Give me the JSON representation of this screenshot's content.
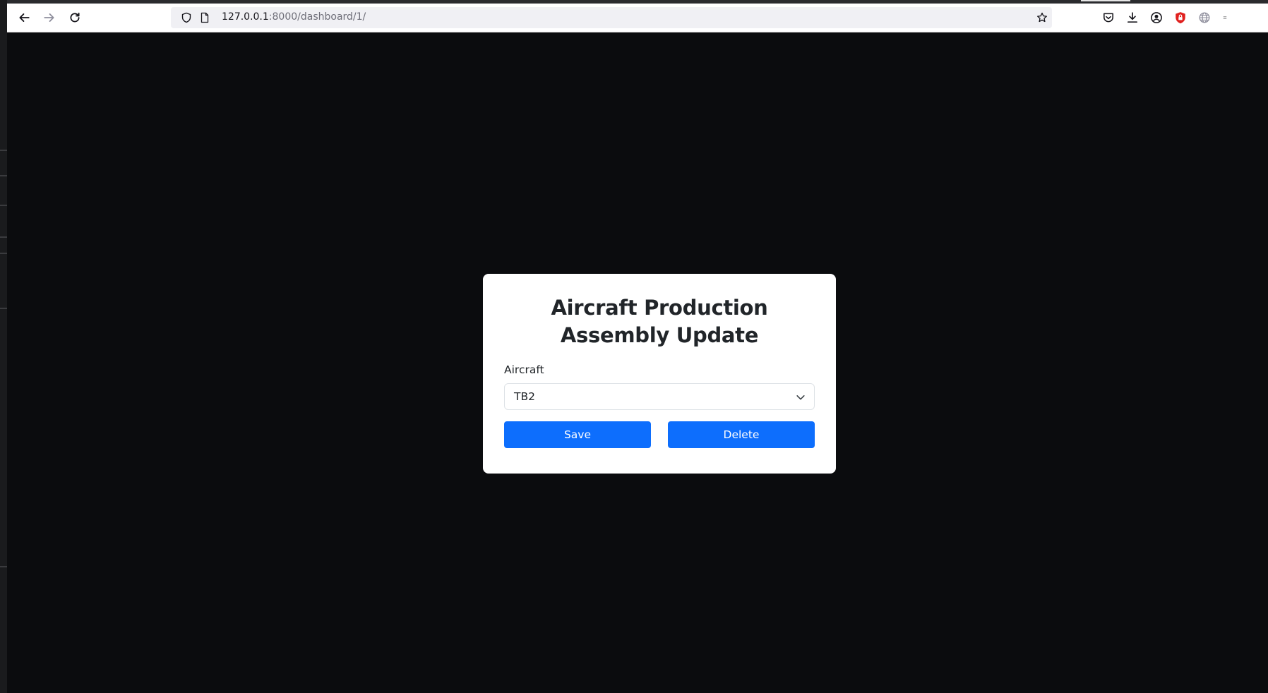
{
  "browser": {
    "url_host": "127.0.0.1",
    "url_rest": ":8000/dashboard/1/",
    "icons": {
      "back": "back-arrow-icon",
      "forward": "forward-arrow-icon",
      "reload": "reload-icon",
      "site_info": "shield-icon",
      "page": "page-icon",
      "bookmark": "star-icon",
      "pocket": "pocket-icon",
      "downloads": "download-icon",
      "account": "account-icon",
      "extension": "lock-badge-icon",
      "translate": "globe-icon"
    }
  },
  "form": {
    "title": "Aircraft Production Assembly Update",
    "aircraft_label": "Aircraft",
    "aircraft_value": "TB2",
    "save_label": "Save",
    "delete_label": "Delete"
  },
  "colors": {
    "page_background": "#0b0c0e",
    "primary_button": "#0d6efd",
    "card_background": "#ffffff"
  }
}
